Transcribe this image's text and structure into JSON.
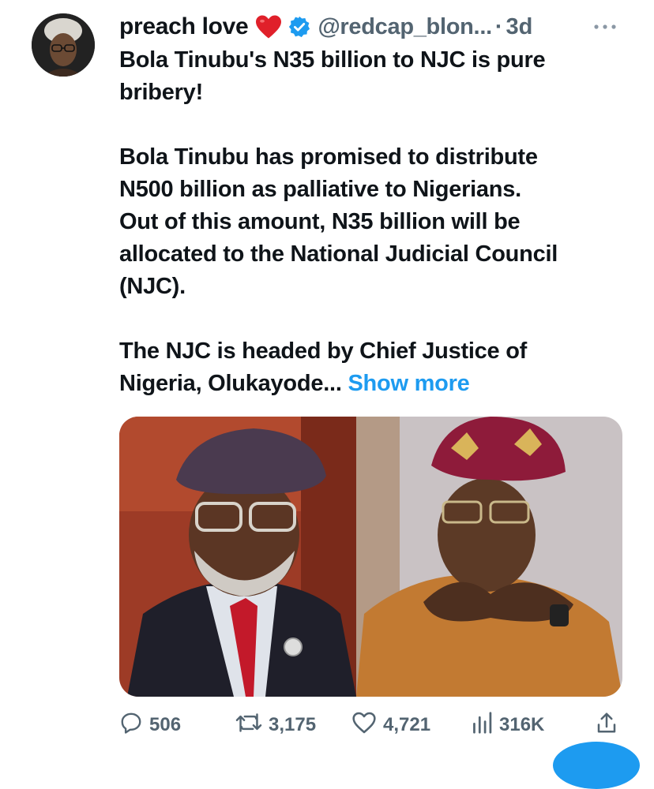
{
  "tweet": {
    "display_name": "preach love",
    "handle": "@redcap_blon...",
    "separator": "·",
    "time": "3d",
    "paragraphs": [
      [
        "Bola Tinubu's N35 billion to NJC is pure",
        "bribery!"
      ],
      [
        "Bola Tinubu has promised to distribute",
        "N500 billion as palliative to Nigerians.",
        "Out of this amount, N35 billion will be",
        "allocated to the National Judicial Council",
        "(NJC)."
      ],
      [
        "The NJC is headed by Chief Justice of"
      ]
    ],
    "last_line": "Nigeria, Olukayode...",
    "show_more": "Show more"
  },
  "actions": {
    "replies": "506",
    "reposts": "3,175",
    "likes": "4,721",
    "views": "316K"
  },
  "icons": [
    "heart-icon",
    "verified-badge-icon",
    "more-icon",
    "reply-icon",
    "repost-icon",
    "like-icon",
    "views-icon",
    "share-icon"
  ],
  "colors": {
    "accent": "#1d9bf0",
    "muted": "#536471",
    "text": "#0f1419",
    "heart": "#e0202a"
  }
}
